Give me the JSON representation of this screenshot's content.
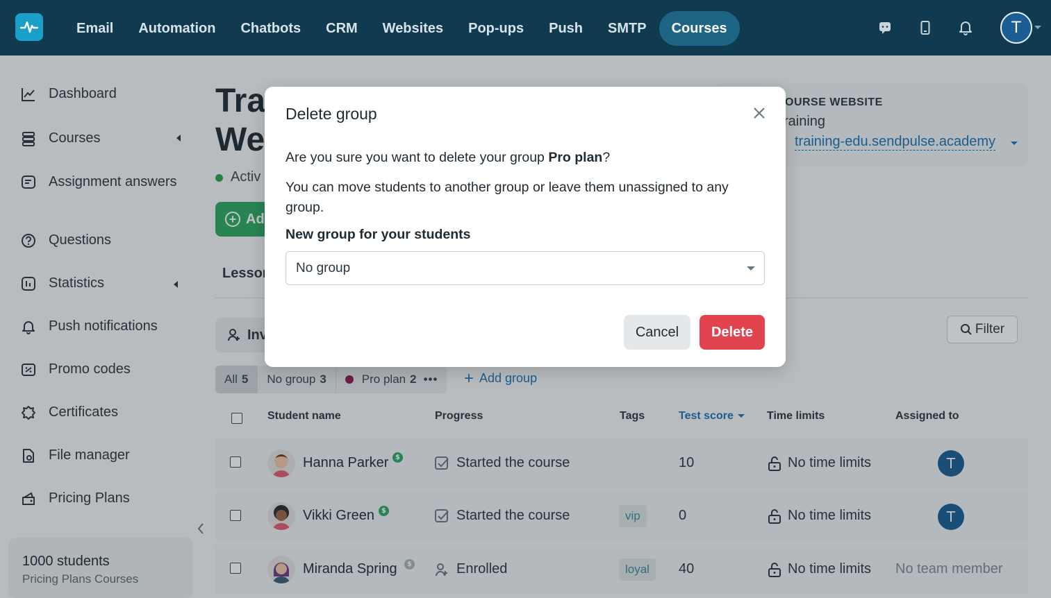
{
  "topnav": {
    "items": [
      "Email",
      "Automation",
      "Chatbots",
      "CRM",
      "Websites",
      "Pop-ups",
      "Push",
      "SMTP",
      "Courses"
    ],
    "active": "Courses",
    "avatar_letter": "T"
  },
  "sidebar": {
    "items": [
      {
        "label": "Dashboard",
        "icon": "chart-line-icon"
      },
      {
        "label": "Courses",
        "icon": "courses-stack-icon"
      },
      {
        "label": "Assignment answers",
        "icon": "assignment-icon"
      },
      {
        "label": "Questions",
        "icon": "question-icon"
      },
      {
        "label": "Statistics",
        "icon": "statistics-icon"
      },
      {
        "label": "Push notifications",
        "icon": "bell-icon"
      },
      {
        "label": "Promo codes",
        "icon": "promo-icon"
      },
      {
        "label": "Certificates",
        "icon": "certificate-icon"
      },
      {
        "label": "File manager",
        "icon": "file-manager-icon"
      },
      {
        "label": "Pricing Plans",
        "icon": "pricing-icon"
      }
    ],
    "students_count": "1000 students",
    "students_plan": "Pricing Plans Courses"
  },
  "main": {
    "title_line1": "Tra",
    "title_line2": "We",
    "status": "Activ",
    "add_label": "Ad",
    "tab_label": "Lessor",
    "invite_label": "Inv",
    "filter_label": "Filter",
    "site": {
      "label": "OURSE WEBSITE",
      "name": "raining",
      "url": "training-edu.sendpulse.academy"
    },
    "groups": {
      "all_label": "All",
      "all_count": "5",
      "nogroup_label": "No group",
      "nogroup_count": "3",
      "pro_label": "Pro plan",
      "pro_count": "2",
      "pro_color": "#8a1a4a",
      "add_group": "Add group"
    },
    "table": {
      "headers": {
        "name": "Student name",
        "progress": "Progress",
        "tags": "Tags",
        "score": "Test score",
        "time": "Time limits",
        "assigned": "Assigned to"
      },
      "rows": [
        {
          "name": "Hanna Parker",
          "progress": "Started the course",
          "tag": "",
          "score": "10",
          "time": "No time limits",
          "assigned": "T",
          "paid": true
        },
        {
          "name": "Vikki Green",
          "progress": "Started the course",
          "tag": "vip",
          "score": "0",
          "time": "No time limits",
          "assigned": "T",
          "paid": true
        },
        {
          "name": "Miranda Spring",
          "progress": "Enrolled",
          "tag": "loyal",
          "score": "40",
          "time": "No time limits",
          "assigned": "No team member",
          "paid": false
        }
      ]
    }
  },
  "modal": {
    "title": "Delete group",
    "question_prefix": "Are you sure you want to delete your group ",
    "group_name": "Pro plan",
    "question_suffix": "?",
    "description": "You can move students to another group or leave them unassigned to any group.",
    "select_label": "New group for your students",
    "select_value": "No group",
    "cancel": "Cancel",
    "delete": "Delete"
  },
  "colors": {
    "nav_bg": "#0f3a4f",
    "accent_blue": "#1a73b5",
    "delete_red": "#e1434f",
    "green": "#2fa862"
  }
}
